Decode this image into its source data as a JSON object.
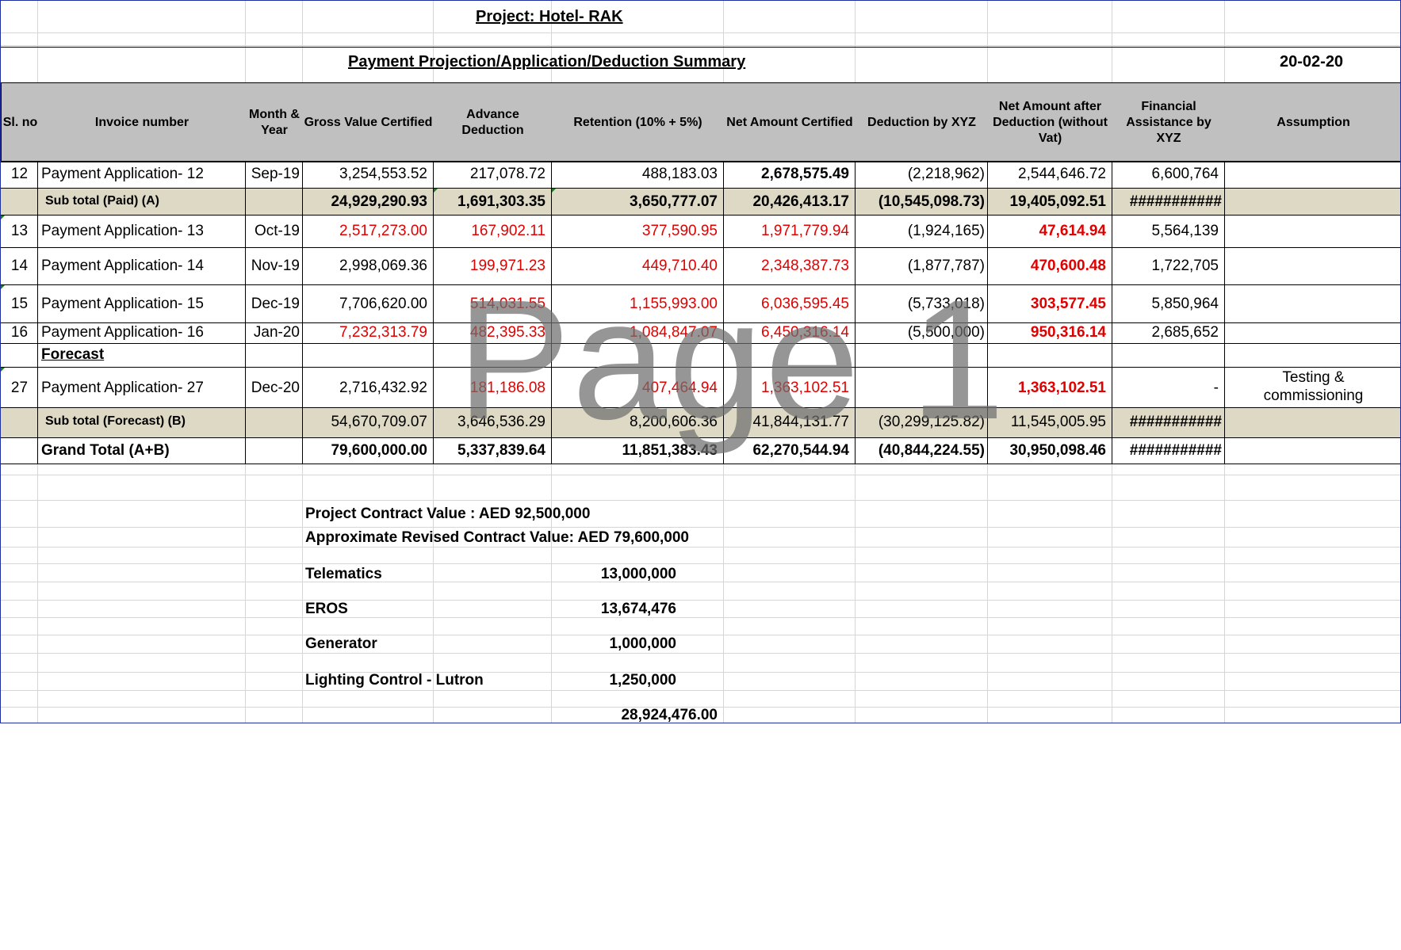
{
  "project_title": "Project:  Hotel- RAK ",
  "summary_title": "Payment Projection/Application/Deduction Summary",
  "date": "20-02-20",
  "headers": [
    "Sl. no",
    "Invoice number",
    "Month & Year",
    "Gross Value Certified",
    "Advance Deduction",
    "Retention (10% + 5%)",
    "Net Amount Certified",
    "Deduction by XYZ",
    "Net Amount after Deduction (without Vat)",
    "Financial Assistance by XYZ",
    "Assumption"
  ],
  "rows": [
    {
      "sl": "12",
      "invoice": "Payment Application- 12",
      "month": "Sep-19",
      "gross": "3,254,553.52",
      "advance": "217,078.72",
      "retention": "488,183.03",
      "net": "2,678,575.49",
      "deduction": "(2,218,962)",
      "net_after": "2,544,646.72",
      "financial": "6,600,764",
      "assumption": ""
    },
    {
      "sl": "13",
      "invoice": "Payment Application- 13",
      "month": "Oct-19",
      "gross": "2,517,273.00",
      "advance": "167,902.11",
      "retention": "377,590.95",
      "net": "1,971,779.94",
      "deduction": "(1,924,165)",
      "net_after": "47,614.94",
      "financial": "5,564,139",
      "assumption": ""
    },
    {
      "sl": "14",
      "invoice": "Payment Application- 14",
      "month": "Nov-19",
      "gross": "2,998,069.36",
      "advance": "199,971.23",
      "retention": "449,710.40",
      "net": "2,348,387.73",
      "deduction": "(1,877,787)",
      "net_after": "470,600.48",
      "financial": "1,722,705",
      "assumption": ""
    },
    {
      "sl": "15",
      "invoice": "Payment Application- 15",
      "month": "Dec-19",
      "gross": "7,706,620.00",
      "advance": "514,031.55",
      "retention": "1,155,993.00",
      "net": "6,036,595.45",
      "deduction": "(5,733,018)",
      "net_after": "303,577.45",
      "financial": "5,850,964",
      "assumption": ""
    },
    {
      "sl": "16",
      "invoice": "Payment Application- 16",
      "month": "Jan-20",
      "gross": "7,232,313.79",
      "advance": "482,395.33",
      "retention": "1,084,847.07",
      "net": "6,450,316.14",
      "deduction": "(5,500,000)",
      "net_after": "950,316.14",
      "financial": "2,685,652",
      "assumption": ""
    },
    {
      "sl": "27",
      "invoice": "Payment Application- 27",
      "month": "Dec-20",
      "gross": "2,716,432.92",
      "advance": "181,186.08",
      "retention": "407,464.94",
      "net": "1,363,102.51",
      "deduction": "",
      "net_after": "1,363,102.51",
      "financial": "-",
      "assumption": "Testing & commissioning"
    }
  ],
  "subtotal_paid": {
    "label": "Sub total (Paid) (A)",
    "gross": "24,929,290.93",
    "advance": "1,691,303.35",
    "retention": "3,650,777.07",
    "net": "20,426,413.17",
    "deduction": "(10,545,098.73)",
    "net_after": "19,405,092.51",
    "financial": "###########"
  },
  "forecast_label": "Forecast",
  "subtotal_forecast": {
    "label": "Sub total (Forecast) (B)",
    "gross": "54,670,709.07",
    "advance": "3,646,536.29",
    "retention": "8,200,606.36",
    "net": "41,844,131.77",
    "deduction": "(30,299,125.82)",
    "net_after": "11,545,005.95",
    "financial": "###########"
  },
  "grand_total": {
    "label": "Grand Total (A+B)",
    "gross": "79,600,000.00",
    "advance": "5,337,839.64",
    "retention": "11,851,383.43",
    "net": "62,270,544.94",
    "deduction": "(40,844,224.55)",
    "net_after": "30,950,098.46",
    "financial": "###########"
  },
  "notes": {
    "contract_value": "Project Contract Value : AED 92,500,000",
    "revised_value": "Approximate Revised Contract Value: AED 79,600,000",
    "items": [
      {
        "label": "Telematics",
        "value": "13,000,000"
      },
      {
        "label": "EROS",
        "value": "13,674,476"
      },
      {
        "label": "Generator",
        "value": "1,000,000"
      },
      {
        "label": "Lighting Control - Lutron",
        "value": "1,250,000"
      }
    ],
    "total": "28,924,476.00"
  },
  "watermark": "Page 1",
  "colors": {
    "header_bg": "#c0c0c0",
    "subtotal_bg": "#ddd9c4",
    "red": "#e00000",
    "border": "#1f2f9f"
  }
}
